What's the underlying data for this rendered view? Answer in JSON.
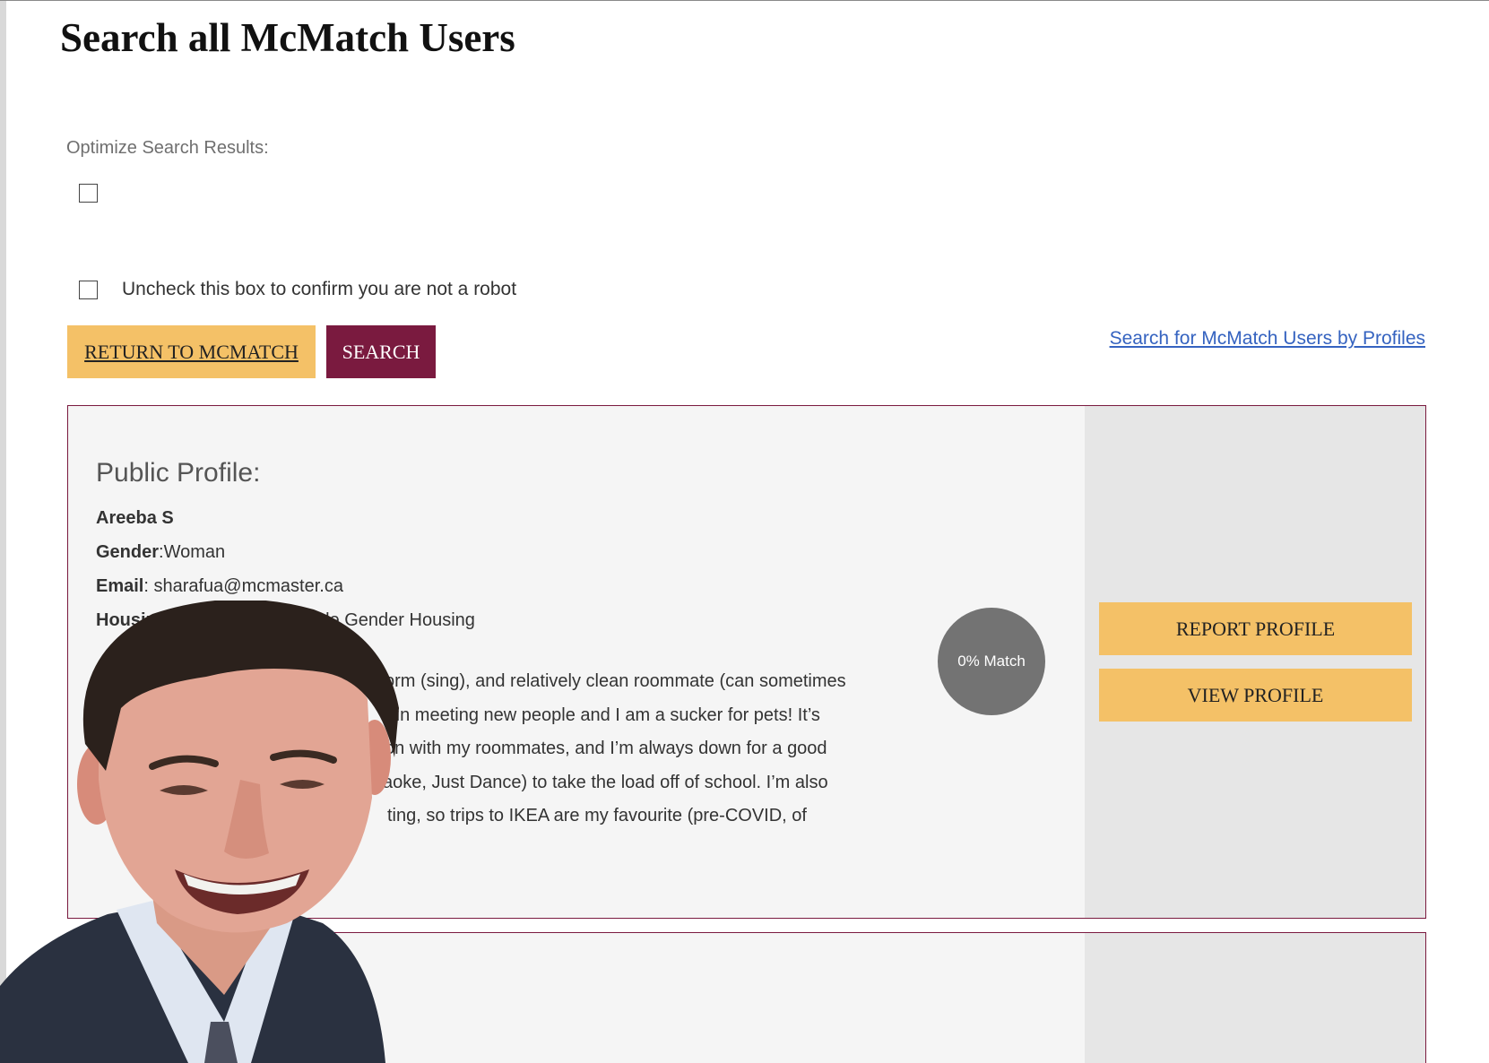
{
  "page": {
    "title": "Search all McMatch Users"
  },
  "search_form": {
    "optimize_label": "Optimize Search Results:",
    "optimize_checked": false,
    "robot_label": "Uncheck this box to confirm you are not a robot",
    "robot_checked": false,
    "return_button": "RETURN TO MCMATCH",
    "search_button": "SEARCH",
    "profiles_link": "Search for McMatch Users by Profiles"
  },
  "results": [
    {
      "heading": "Public Profile:",
      "name": "Areeba S",
      "gender_label": "Gender",
      "gender_value": ":Woman",
      "email_label": "Email",
      "email_value": ": sharafua@mcmaster.ca",
      "housing_label": "Housing",
      "housing_value": "gle Gender Housing",
      "bio_lines": [
        "orm (sing), and relatively clean roommate (can sometimes",
        "d in meeting new people and I am a sucker for pets! It’s",
        "on with my roommates, and I’m always down for a good",
        "aoke, Just Dance) to take the load off of school. I’m also",
        "ting, so trips to IKEA are my favourite (pre-COVID, of"
      ],
      "match": "0% Match",
      "report_button": "REPORT PROFILE",
      "view_button": "VIEW PROFILE"
    }
  ],
  "overlay": {
    "icon": "person-grimace-photo"
  },
  "colors": {
    "accent_gold": "#f4c167",
    "accent_maroon": "#7a1a3f",
    "link_blue": "#3563c0",
    "match_gray": "#737373"
  }
}
